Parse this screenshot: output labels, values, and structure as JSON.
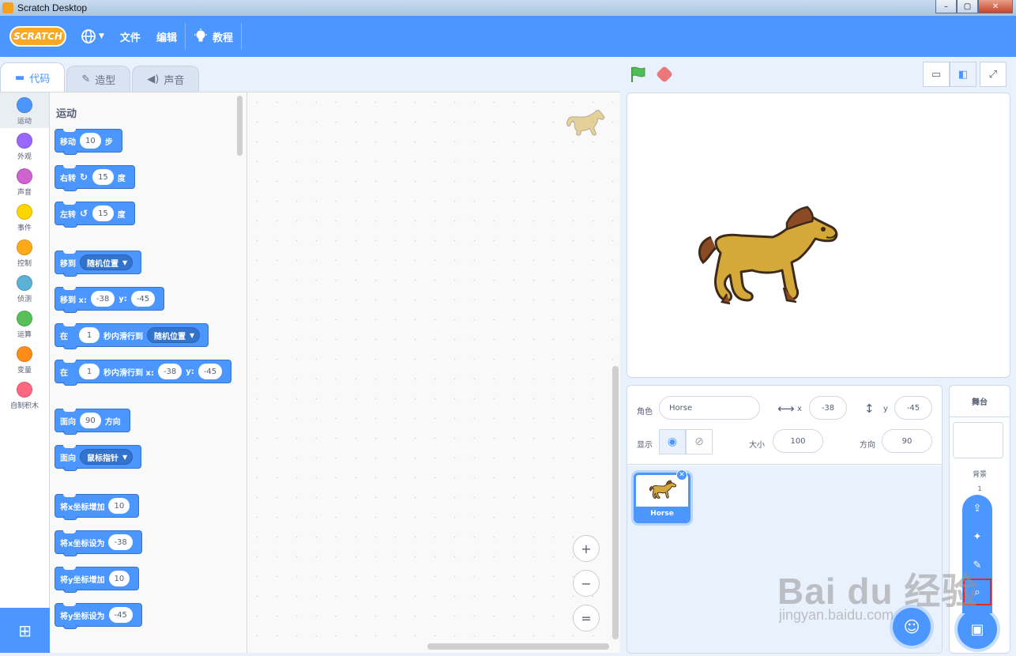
{
  "window": {
    "title": "Scratch Desktop",
    "controls": [
      "–",
      "▢",
      "✕"
    ]
  },
  "menubar": {
    "logo": "SCRATCH",
    "language_icon": "globe-icon",
    "file": "文件",
    "edit": "编辑",
    "tutorials": "教程"
  },
  "tabs": [
    {
      "label": "代码",
      "icon": "code-icon",
      "active": true
    },
    {
      "label": "造型",
      "icon": "brush-icon",
      "active": false
    },
    {
      "label": "声音",
      "icon": "speaker-icon",
      "active": false
    }
  ],
  "categories": [
    {
      "label": "运动",
      "color": "#4c97ff"
    },
    {
      "label": "外观",
      "color": "#9966ff"
    },
    {
      "label": "声音",
      "color": "#cf63cf"
    },
    {
      "label": "事件",
      "color": "#ffd500"
    },
    {
      "label": "控制",
      "color": "#ffab19"
    },
    {
      "label": "侦测",
      "color": "#5cb1d6"
    },
    {
      "label": "运算",
      "color": "#59c059"
    },
    {
      "label": "变量",
      "color": "#ff8c1a"
    },
    {
      "label": "自制积木",
      "color": "#ff6680"
    }
  ],
  "palette": {
    "title": "运动",
    "blocks": {
      "move": {
        "t1": "移动",
        "v": "10",
        "t2": "步"
      },
      "turn_right": {
        "t1": "右转",
        "v": "15",
        "t2": "度"
      },
      "turn_left": {
        "t1": "左转",
        "v": "15",
        "t2": "度"
      },
      "goto": {
        "t1": "移到",
        "dd": "随机位置"
      },
      "goto_xy": {
        "t1": "移到 x:",
        "x": "-38",
        "t2": "y:",
        "y": "-45"
      },
      "glide": {
        "t1": "在",
        "v": "1",
        "t2": "秒内滑行到",
        "dd": "随机位置"
      },
      "glide_xy": {
        "t1": "在",
        "v": "1",
        "t2": "秒内滑行到 x:",
        "x": "-38",
        "t3": "y:",
        "y": "-45"
      },
      "point_dir": {
        "t1": "面向",
        "v": "90",
        "t2": "方向"
      },
      "point_towards": {
        "t1": "面向",
        "dd": "鼠标指针"
      },
      "change_x": {
        "t1": "将x坐标增加",
        "v": "10"
      },
      "set_x": {
        "t1": "将x坐标设为",
        "v": "-38"
      },
      "change_y": {
        "t1": "将y坐标增加",
        "v": "10"
      },
      "set_y": {
        "t1": "将y坐标设为",
        "v": "-45"
      }
    }
  },
  "code_area": {
    "zoom_in": "+",
    "zoom_out": "−",
    "zoom_reset": "="
  },
  "sprite_info": {
    "sprite_label": "角色",
    "sprite_name": "Horse",
    "x_label": "x",
    "x": "-38",
    "y_label": "y",
    "y": "-45",
    "show_label": "显示",
    "size_label": "大小",
    "size": "100",
    "direction_label": "方向",
    "direction": "90"
  },
  "sprites": [
    {
      "name": "Horse",
      "selected": true
    }
  ],
  "stage_selector": {
    "title": "舞台",
    "backdrops_label": "背景",
    "backdrops_count": "1"
  },
  "watermark": {
    "main": "Bai du 经验",
    "sub": "jingyan.baidu.com"
  },
  "colors": {
    "accent": "#4c97ff",
    "menubar": "#4c97ff",
    "highlight": "#e8262a"
  }
}
